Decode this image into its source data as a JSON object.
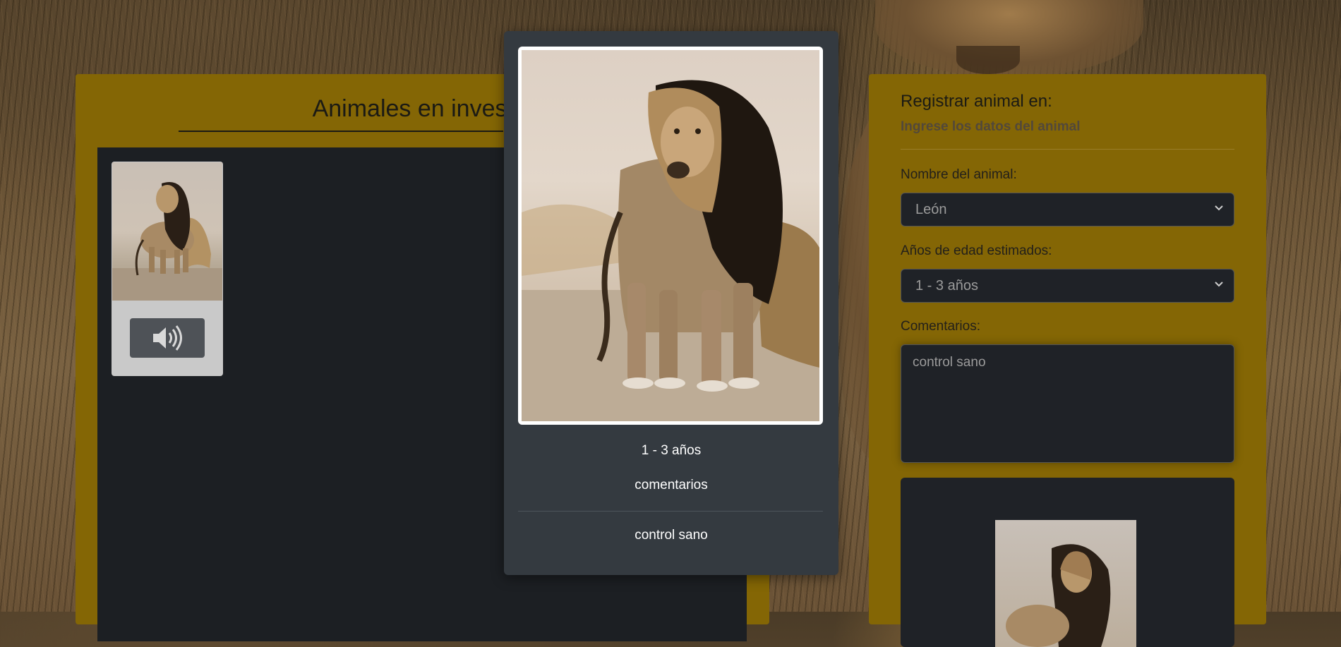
{
  "gallery": {
    "title": "Animales en investig",
    "thumb_alt": "León",
    "audio_button": "audio"
  },
  "modal": {
    "age": "1 - 3 años",
    "comments_label": "comentarios",
    "comments_value": "control sano"
  },
  "form": {
    "title": "Registrar animal en:",
    "subtitle": "Ingrese los datos del animal",
    "name_label": "Nombre del animal:",
    "name_value": "León",
    "age_label": "Años de edad estimados:",
    "age_value": "1 - 3 años",
    "comments_label": "Comentarios:",
    "comments_value": "control sano"
  },
  "colors": {
    "panel_bg": "#846605",
    "dark_bg": "#1c1f23",
    "modal_bg": "#343a40"
  }
}
